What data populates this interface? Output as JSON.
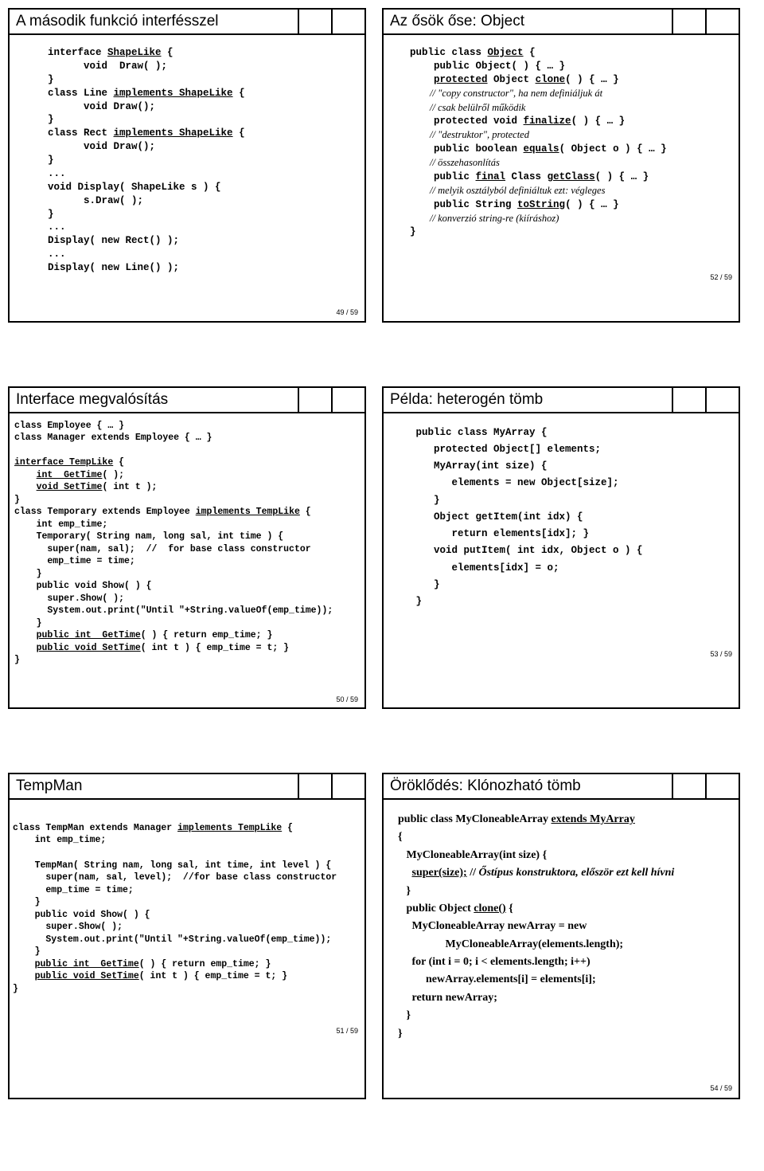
{
  "slides": {
    "s1": {
      "title": "A második funkció interfésszel",
      "page": "49 / 59",
      "l1": "interface ",
      "l1u": "ShapeLike",
      "l1b": " {",
      "l2": "      void  Draw( );",
      "l3": "}",
      "l4": "class Line ",
      "l4u": "implements ShapeLike",
      "l4b": " {",
      "l5": "      void Draw();",
      "l6": "}",
      "l7": "class Rect ",
      "l7u": "implements ShapeLike",
      "l7b": " {",
      "l8": "      void Draw();",
      "l9": "}",
      "l10": "...",
      "l11": "void Display( ShapeLike s ) {",
      "l12": "      s.Draw( );",
      "l13": "}",
      "l14": "...",
      "l15": "Display( new Rect() );",
      "l16": "...",
      "l17": "Display( new Line() );"
    },
    "s2": {
      "title": "Az ősök őse: Object",
      "page": "52 / 59",
      "l1": "public class ",
      "l1u": "Object",
      "l1b": " {",
      "l2": "    public Object( ) { … }",
      "l3a": "    ",
      "l3u": "protected",
      "l3b": " Object ",
      "l3u2": "clone",
      "l3c": "( ) { … }",
      "l4": "        // \"copy constructor\", ha nem definiáljuk át",
      "l5": "        // csak belülről működik",
      "l6a": "    protected void ",
      "l6u": "finalize",
      "l6b": "( ) { … }",
      "l7": "        // \"destruktor\", protected",
      "l8a": "    public boolean ",
      "l8u": "equals",
      "l8b": "( Object o ) { … }",
      "l9": "        // összehasonlítás",
      "l10a": "    public ",
      "l10u": "final",
      "l10b": " Class ",
      "l10u2": "getClass",
      "l10c": "( ) { … }",
      "l11": "        // melyik osztályból definiáltuk ezt: végleges",
      "l12a": "    public String ",
      "l12u": "toString",
      "l12b": "( ) { … }",
      "l13": "        // konverzió string-re (kiíráshoz)",
      "l14": "}"
    },
    "s3": {
      "title": "Interface megvalósítás",
      "page": "50 / 59",
      "l1": "class Employee { … }",
      "l2": "class Manager extends Employee { … }",
      "l3u": "interface TempLike",
      "l3b": " {",
      "l4a": "    ",
      "l4u": "int  GetTime",
      "l4b": "( );",
      "l5a": "    ",
      "l5u": "void SetTime",
      "l5b": "( int t );",
      "l6": "}",
      "l7a": "class Temporary extends Employee ",
      "l7u": "implements TempLike",
      "l7b": " {",
      "l8": "    int emp_time;",
      "l9": "    Temporary( String nam, long sal, int time ) {",
      "l10": "      super(nam, sal);  //  for base class constructor",
      "l11": "      emp_time = time;",
      "l12": "    }",
      "l13": "    public void Show( ) {",
      "l14": "      super.Show( );",
      "l15": "      System.out.print(\"Until \"+String.valueOf(emp_time));",
      "l16": "    }",
      "l17a": "    ",
      "l17u": "public int  GetTime",
      "l17b": "( ) { return emp_time; }",
      "l18a": "    ",
      "l18u": "public void SetTime",
      "l18b": "( int t ) { emp_time = t; }",
      "l19": "}"
    },
    "s4": {
      "title": "Példa: heterogén tömb",
      "page": "53 / 59",
      "l1": "public class MyArray {",
      "l2": "   protected Object[] elements;",
      "l3": "   MyArray(int size) {",
      "l4": "      elements = new Object[size];",
      "l5": "   }",
      "l6": "   Object getItem(int idx) {",
      "l7": "      return elements[idx]; }",
      "l8": "   void putItem( int idx, Object o ) {",
      "l9": "      elements[idx] = o;",
      "l10": "   }",
      "l11": "}"
    },
    "s5": {
      "title": "TempMan",
      "page": "51 / 59",
      "l1a": "class TempMan extends Manager ",
      "l1u": "implements TempLike",
      "l1b": " {",
      "l2": "    int emp_time;",
      "l3": "",
      "l4": "    TempMan( String nam, long sal, int time, int level ) {",
      "l5": "      super(nam, sal, level);  //for base class constructor",
      "l6": "      emp_time = time;",
      "l7": "    }",
      "l8": "    public void Show( ) {",
      "l9": "      super.Show( );",
      "l10": "      System.out.print(\"Until \"+String.valueOf(emp_time));",
      "l11": "    }",
      "l12a": "    ",
      "l12u": "public int  GetTime",
      "l12b": "( ) { return emp_time; }",
      "l13a": "    ",
      "l13u": "public void SetTime",
      "l13b": "( int t ) { emp_time = t; }",
      "l14": "}"
    },
    "s6": {
      "title": "Öröklődés: Klónozható tömb",
      "page": "54 / 59",
      "l1a": "public class MyCloneableArray ",
      "l1u": "extends MyArray",
      "l2": "{",
      "l3": "   MyCloneableArray(int size) {",
      "l4a": "     ",
      "l4u": "super(size);",
      "l4b": " // ",
      "l4i": "Őstípus konstruktora, először ezt kell hívni",
      "l5": "   }",
      "l6a": "   public Object ",
      "l6u": "clone()",
      "l6b": " {",
      "l7": "     MyCloneableArray newArray = new",
      "l8": "                 MyCloneableArray(elements.length);",
      "l9": "     for (int i = 0; i < elements.length; i++)",
      "l10": "          newArray.elements[i] = elements[i];",
      "l11": "     return newArray;",
      "l12": "   }",
      "l13": "}"
    }
  }
}
